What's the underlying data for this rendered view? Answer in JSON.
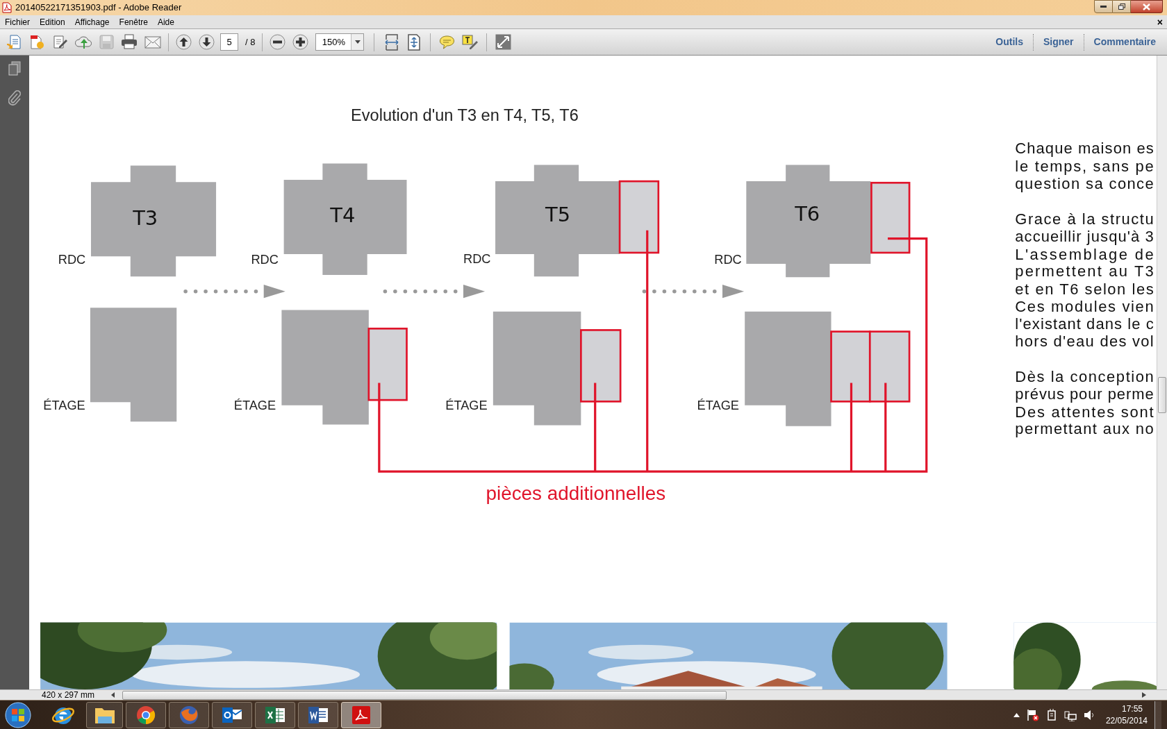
{
  "window": {
    "title": "20140522171351903.pdf - Adobe Reader"
  },
  "menu_bar": {
    "items": [
      "Fichier",
      "Edition",
      "Affichage",
      "Fenêtre",
      "Aide"
    ],
    "close": "×"
  },
  "toolbar": {
    "page_number": "5",
    "page_count": "/ 8",
    "zoom": "150%",
    "panes": [
      "Outils",
      "Signer",
      "Commentaire"
    ]
  },
  "document": {
    "diagram_title": "Evolution d'un T3 en T4, T5, T6",
    "plans": [
      {
        "name": "T3",
        "ground_floor": "RDC",
        "upper_floor": "ÉTAGE"
      },
      {
        "name": "T4",
        "ground_floor": "RDC",
        "upper_floor": "ÉTAGE"
      },
      {
        "name": "T5",
        "ground_floor": "RDC",
        "upper_floor": "ÉTAGE"
      },
      {
        "name": "T6",
        "ground_floor": "RDC",
        "upper_floor": "ÉTAGE"
      }
    ],
    "legend": "pièces additionnelles",
    "body_text": [
      "Chaque maison es",
      "le temps, sans pe",
      "question sa conce",
      "Grace à la structu",
      "accueillir jusqu'à 3",
      "L'assemblage de",
      "permettent au T3",
      "et en T6 selon les",
      "Ces modules vien",
      "l'existant dans le c",
      "hors d'eau des vol",
      "Dès la conception",
      "prévus pour perme",
      "Des attentes sont",
      "permettant aux no"
    ]
  },
  "status_bar": {
    "page_size": "420 x 297 mm"
  },
  "taskbar": {
    "time": "17:55",
    "date": "22/05/2014"
  }
}
